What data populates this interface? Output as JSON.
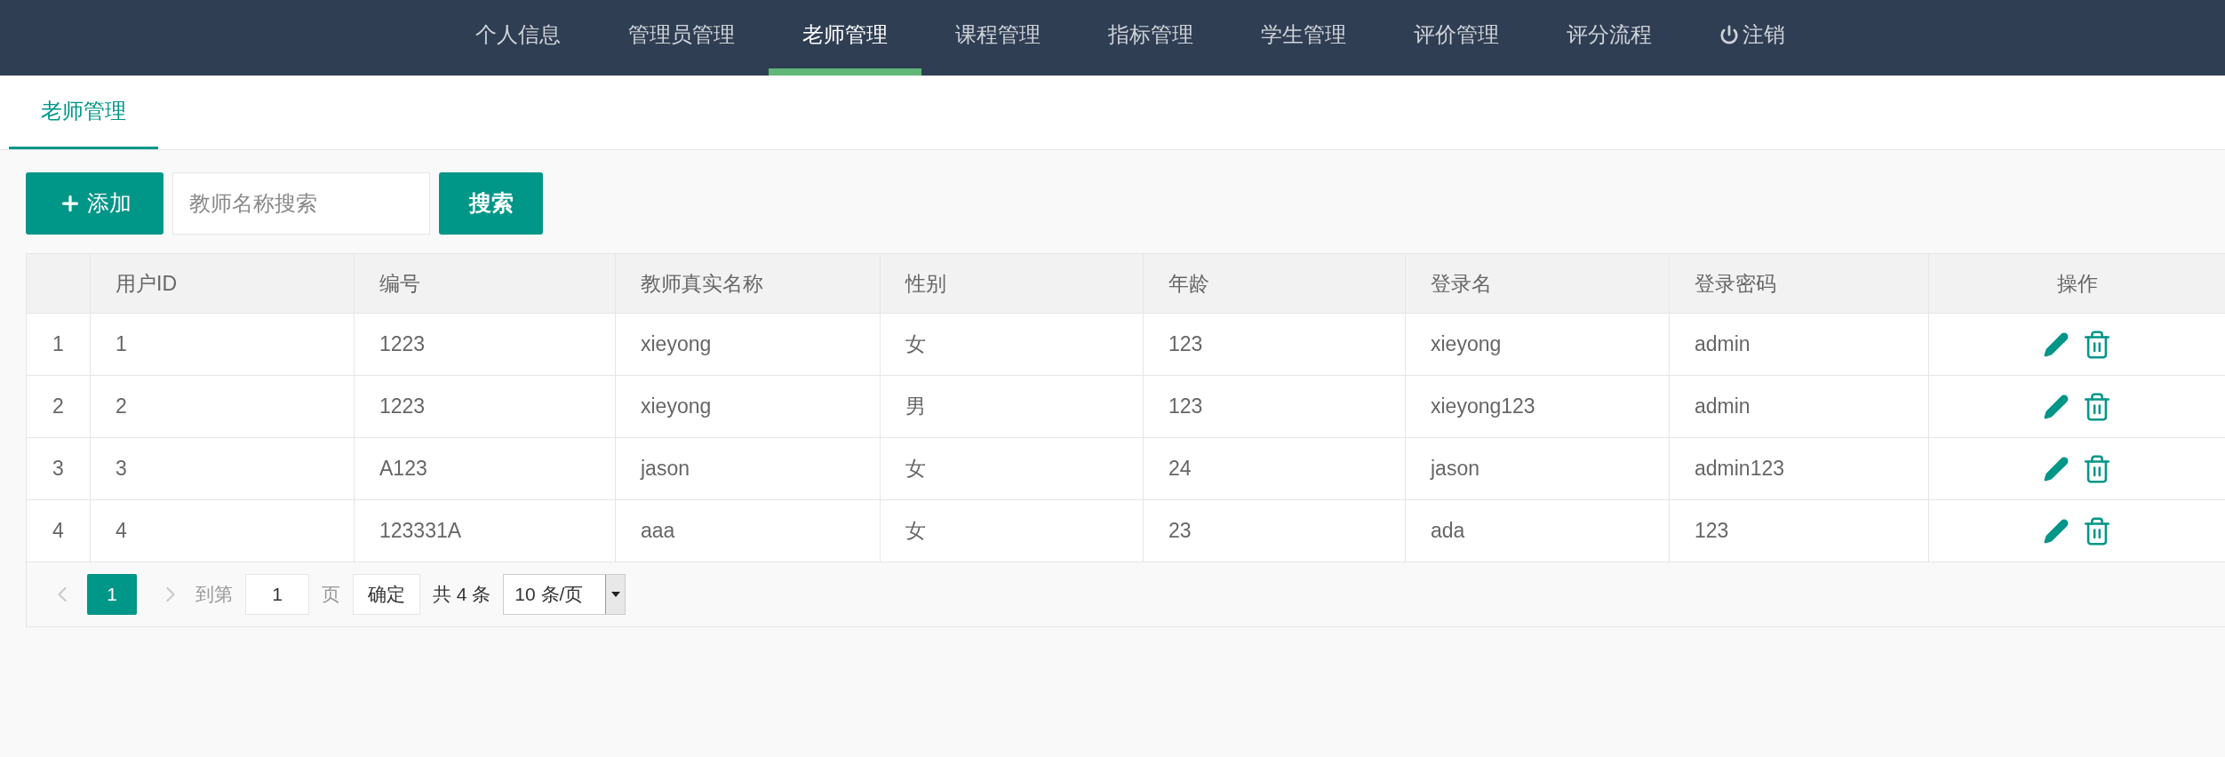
{
  "nav": {
    "items": [
      {
        "label": "个人信息",
        "kind": "link",
        "selected": false
      },
      {
        "label": "管理员管理",
        "kind": "link",
        "selected": false
      },
      {
        "label": "老师管理",
        "kind": "link",
        "selected": true
      },
      {
        "label": "课程管理",
        "kind": "link",
        "selected": false
      },
      {
        "label": "指标管理",
        "kind": "link",
        "selected": false
      },
      {
        "label": "学生管理",
        "kind": "link",
        "selected": false
      },
      {
        "label": "评价管理",
        "kind": "link",
        "selected": false
      },
      {
        "label": "评分流程",
        "kind": "link",
        "selected": false
      },
      {
        "label": "注销",
        "kind": "logout",
        "selected": false
      }
    ]
  },
  "tabs": [
    {
      "label": "老师管理",
      "selected": true
    }
  ],
  "toolbar": {
    "add_button": "添加",
    "search": {
      "placeholder": "教师名称搜索"
    },
    "search_button": "搜索"
  },
  "table": {
    "columns": [
      "用户ID",
      "编号",
      "教师真实名称",
      "性别",
      "年龄",
      "登录名",
      "登录密码",
      "操作"
    ],
    "rows": [
      {
        "index": "1",
        "cells": [
          "1",
          "1223",
          "xieyong",
          "女",
          "123",
          "xieyong",
          "admin"
        ]
      },
      {
        "index": "2",
        "cells": [
          "2",
          "1223",
          "xieyong",
          "男",
          "123",
          "xieyong123",
          "admin"
        ]
      },
      {
        "index": "3",
        "cells": [
          "3",
          "A123",
          "jason",
          "女",
          "24",
          "jason",
          "admin123"
        ]
      },
      {
        "index": "4",
        "cells": [
          "4",
          "123331A",
          "aaa",
          "女",
          "23",
          "ada",
          "123"
        ]
      }
    ]
  },
  "pagination": {
    "prev": {
      "disabled": true
    },
    "pages": [
      {
        "label": "1",
        "selected": true
      }
    ],
    "next": {
      "disabled": true
    },
    "goto_label": "到第",
    "goto_value": "1",
    "page_unit": "页",
    "confirm": "确定",
    "total": "共 4 条",
    "page_size": "10 条/页"
  }
}
